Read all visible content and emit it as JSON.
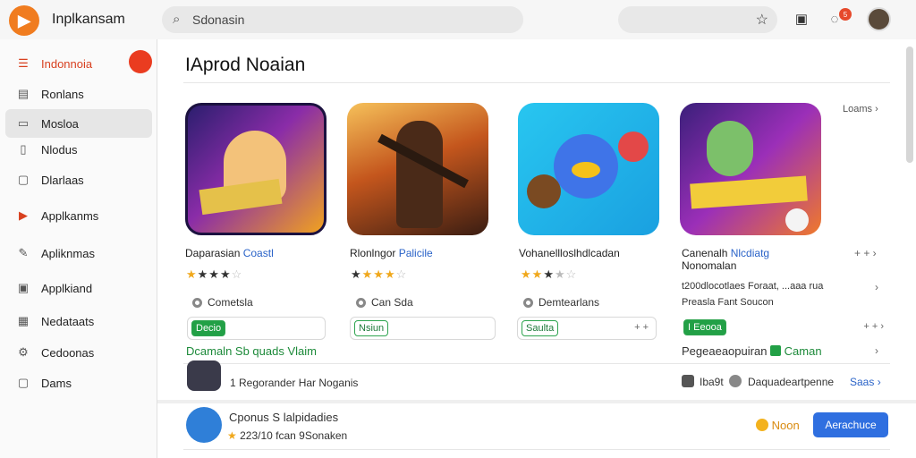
{
  "topbar": {
    "app_name": "Inplkansam",
    "search_placeholder": "Sdonasin",
    "logo_icon": "app-logo-icon",
    "notification_count": "5",
    "icons": [
      "star-icon",
      "chat-icon",
      "message-icon"
    ]
  },
  "sidebar": {
    "items": [
      {
        "label": "Indonnoia",
        "icon": "list-icon"
      },
      {
        "label": "Ronlans",
        "icon": "grid-icon"
      },
      {
        "label": "Mosloa",
        "icon": "folder-icon"
      },
      {
        "label": "Nlodus",
        "icon": "document-icon"
      },
      {
        "label": "Dlarlaas",
        "icon": "file-icon"
      },
      {
        "label": "Applkanms",
        "icon": "play-icon"
      },
      {
        "label": "Apliknmas",
        "icon": "pen-icon"
      },
      {
        "label": "Applkiand",
        "icon": "gallery-icon"
      },
      {
        "label": "Nedataats",
        "icon": "table-icon"
      },
      {
        "label": "Cedoonas",
        "icon": "gear-icon"
      },
      {
        "label": "Dams",
        "icon": "box-icon"
      }
    ]
  },
  "main": {
    "title": "IAprod Noaian",
    "see_all": "Loams",
    "apps": [
      {
        "title_a": "Daparasian ",
        "title_b": "Coastl",
        "rating": 3,
        "rating_extra": "",
        "category": "Cometsla",
        "tag": "Decio",
        "tag_fill": true
      },
      {
        "title_a": "Rlonlngor ",
        "title_b": "Palicile",
        "rating": 4,
        "rating_extra": "",
        "category": "Can Sda",
        "tag": "Nsiun",
        "tag_fill": false
      },
      {
        "title_a": "Vohanellloslhdlcadan",
        "title_b": "",
        "rating": 3,
        "rating_extra": "",
        "category": "Demtearlans",
        "tag": "Saulta",
        "tag_fill": false
      },
      {
        "title_a": "Canenalh ",
        "title_b": "Nlcdiatg",
        "title_line2": "Nonomalan",
        "rating": 0,
        "rating_extra": "",
        "category": "",
        "tag": "I Eeooa",
        "tag_fill": true
      }
    ],
    "row_texts": {
      "app4_meta": "t200dlocotlaes Foraat, ...aaa rua",
      "app4_meta2": "Preasla Fant Soucon",
      "green_link": "Dcamaln Sb quads Vlaim",
      "regular_text": "1 Regorander Har Noganis",
      "right_label": "Pegeaeaopuiran",
      "right_label2": "Caman",
      "tiny1": "Iba9t",
      "tiny2": "Daquadeartpenne",
      "see_link": "Saas"
    },
    "bottom": {
      "title": "Cponus S lalpidadies",
      "meta": "223/10 fcan 9Sonaken",
      "secondary": "Noon",
      "button": "Aerachuce"
    }
  },
  "colors": {
    "accent": "#d8401f",
    "link": "#2a63c8",
    "green": "#22a046",
    "primary_button": "#2f6fe0"
  }
}
